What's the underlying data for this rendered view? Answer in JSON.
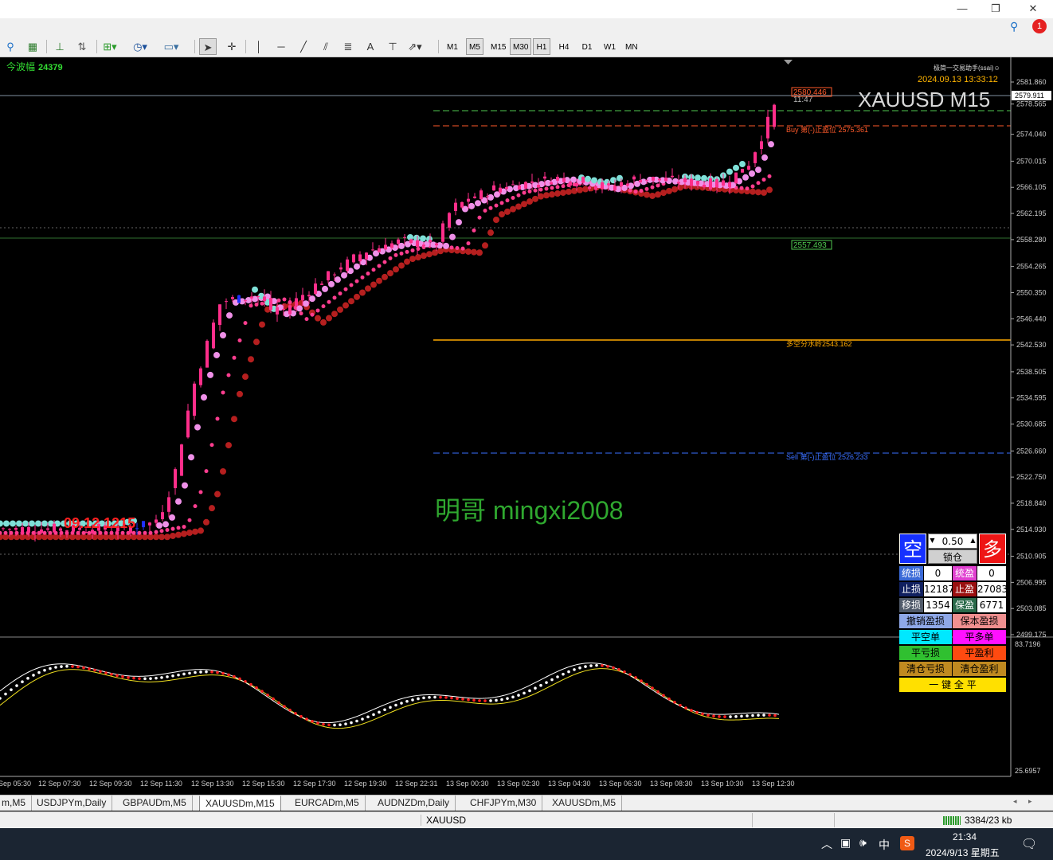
{
  "window": {
    "min": "—",
    "restore": "❐",
    "close": "✕"
  },
  "toolbar": {
    "timeframes": [
      "M1",
      "M5",
      "M15",
      "M30",
      "H1",
      "H4",
      "D1",
      "W1",
      "MN"
    ],
    "active_timeframe": "M15",
    "notification_count": "1"
  },
  "chart": {
    "symbol_title": "XAUUSD M15",
    "datetime": "2024.09.13 13:33:12",
    "assistant_label": "极简一交易助手(ssai)☺",
    "bar_timer": "11:47",
    "wave_label": "今波幅",
    "wave_value": "24379",
    "price_line": "2580.446",
    "bid_price": "2579.911",
    "support_price": "2557.493",
    "buy_label": "Buy 第(-)止盈位 2575.361",
    "divider_label": "多空分水岭2543.162",
    "sell_label": "Sell 第(-)止盈位 2526.233",
    "watermark": "明哥 mingxi2008",
    "red_marker": "09.12 1215",
    "price_axis": [
      "2581.860",
      "2578.565",
      "2574.040",
      "2570.015",
      "2566.105",
      "2562.195",
      "2558.280",
      "2554.265",
      "2550.350",
      "2546.440",
      "2542.530",
      "2538.505",
      "2534.595",
      "2530.685",
      "2526.660",
      "2522.750",
      "2518.840",
      "2514.930",
      "2510.905",
      "2506.995",
      "2503.085",
      "2499.175"
    ],
    "indicator_axis": [
      "83.7196",
      "25.6957"
    ],
    "time_axis": [
      "Sep 05:30",
      "12 Sep 07:30",
      "12 Sep 09:30",
      "12 Sep 11:30",
      "12 Sep 13:30",
      "12 Sep 15:30",
      "12 Sep 17:30",
      "12 Sep 19:30",
      "12 Sep 22:31",
      "13 Sep 00:30",
      "13 Sep 02:30",
      "13 Sep 04:30",
      "13 Sep 06:30",
      "13 Sep 08:30",
      "13 Sep 10:30",
      "13 Sep 12:30"
    ]
  },
  "panel": {
    "sell_btn": "空",
    "buy_btn": "多",
    "lot": "0.50",
    "lock_btn": "锁仓",
    "sl_total_label": "统损",
    "sl_total": "0",
    "tp_total_label": "统盈",
    "tp_total": "0",
    "sl_label": "止损",
    "sl": "12187",
    "tp_label": "止盈",
    "tp": "27083",
    "trail_label": "移损",
    "trail": "1354",
    "be_label": "保盈",
    "be": "6771",
    "cancel_sltp": "撤销盈损",
    "breakeven": "保本盈损",
    "close_short": "平空单",
    "close_long": "平多单",
    "close_loss": "平亏损",
    "close_profit": "平盈利",
    "clear_loss": "清仓亏损",
    "clear_profit": "清仓盈利",
    "close_all": "一 键 全 平"
  },
  "tabs": [
    "m,M5",
    "USDJPYm,Daily",
    "GBPAUDm,M5",
    "XAUUSDm,M15",
    "EURCADm,M5",
    "AUDNZDm,Daily",
    "CHFJPYm,M30",
    "XAUUSDm,M5"
  ],
  "active_tab": "XAUUSDm,M15",
  "status": {
    "symbol": "XAUUSD",
    "traffic": "3384/23 kb"
  },
  "taskbar": {
    "ime": "中",
    "time": "21:34",
    "date": "2024/9/13 星期五"
  },
  "colors": {
    "bull": "#ff2e8a",
    "bear": "#1f2fff",
    "ma_fast": "#7fe0d8",
    "ma_pink": "#ef90e8",
    "ma_mid": "#ff3d8f",
    "ma_slow": "#b51f1f",
    "buy_line": "#ff5a2a",
    "sell_line": "#3a6fff",
    "divider": "#ffaa00"
  }
}
